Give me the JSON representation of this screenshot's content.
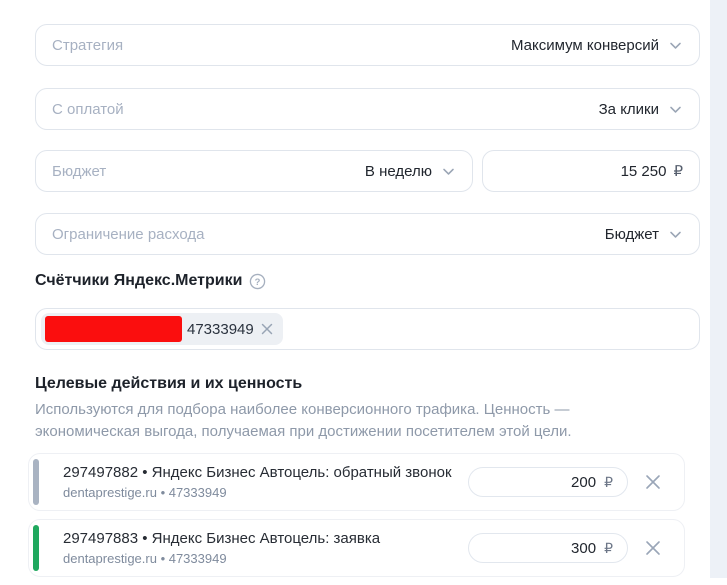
{
  "page": {
    "background": "#ffffff",
    "right_rail_color": "#edf1f7"
  },
  "fields": {
    "strategy": {
      "label": "Стратегия",
      "value": "Максимум конверсий"
    },
    "payment": {
      "label": "С оплатой",
      "value": "За клики"
    },
    "budget": {
      "label": "Бюджет",
      "period_value": "В неделю",
      "amount": "15 250",
      "currency": "₽"
    },
    "spend_limit": {
      "label": "Ограничение расхода",
      "value": "Бюджет"
    }
  },
  "metrika": {
    "heading": "Счётчики Яндекс.Метрики",
    "help_icon": "question-circle-icon",
    "chip": {
      "counter_id": "47333949",
      "redacted_color": "#fb0e0e",
      "remove_icon": "x-icon"
    }
  },
  "goals_section": {
    "heading": "Целевые действия и их ценность",
    "description_lines": [
      "Используются для подбора наиболее конверсионного трафика. Ценность —",
      "экономическая выгода, получаемая при достижении посетителем этой цели."
    ],
    "goals": [
      {
        "title": "297497882 • Яндекс Бизнес Автоцель: обратный звонок",
        "source": "dentaprestige.ru • 47333949",
        "value": "200",
        "currency": "₽",
        "bar_color": "#a9b3c2"
      },
      {
        "title": "297497883 • Яндекс Бизнес Автоцель: заявка",
        "source": "dentaprestige.ru • 47333949",
        "value": "300",
        "currency": "₽",
        "bar_color": "#1fa85e"
      }
    ]
  },
  "icons": {
    "chevron": "chevron-down",
    "help": "question-circle",
    "remove": "x"
  }
}
